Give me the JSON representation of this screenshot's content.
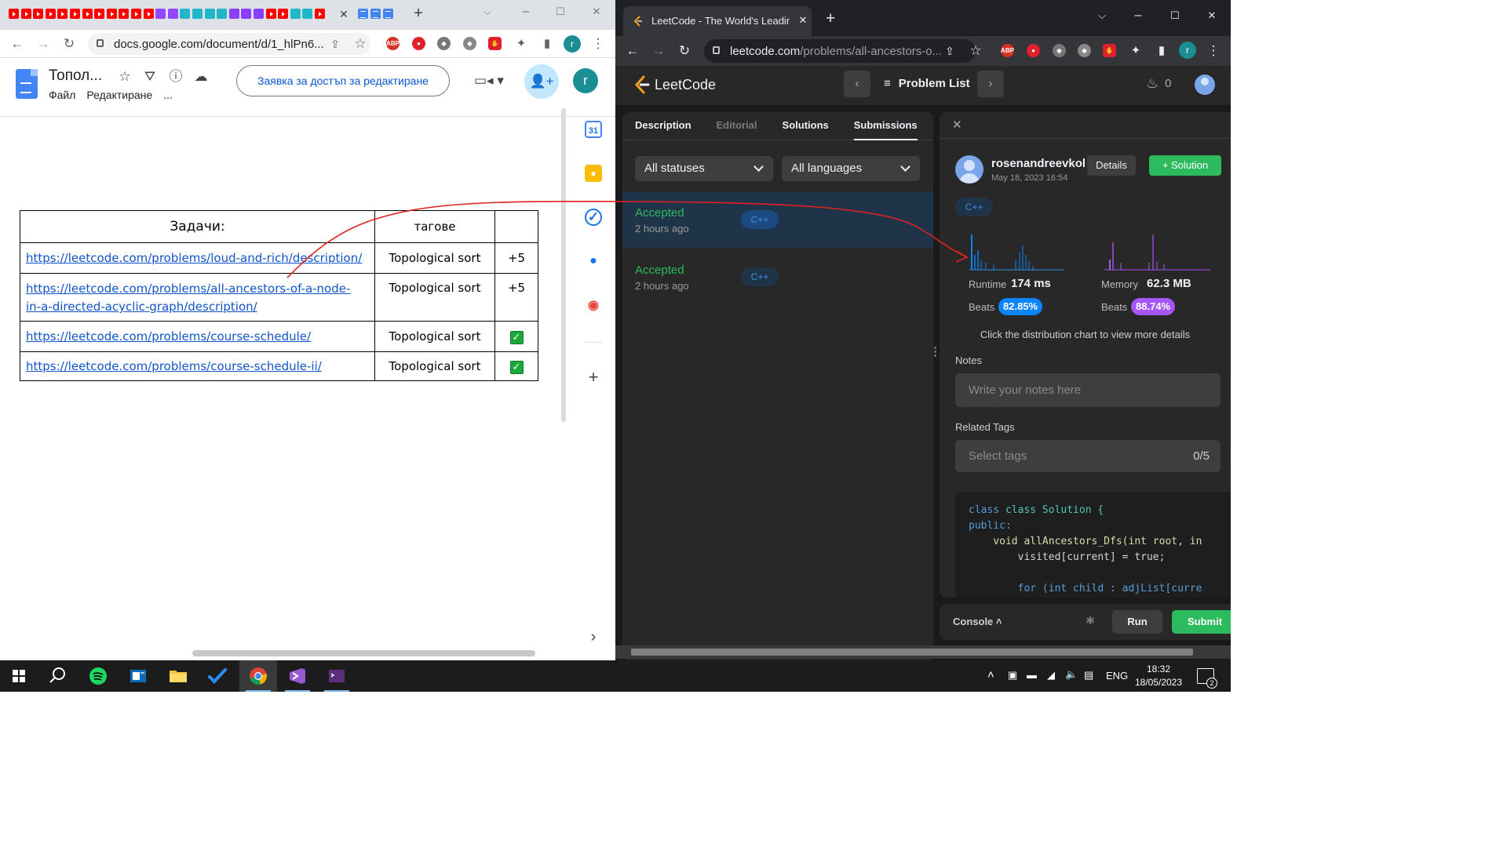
{
  "left_browser": {
    "tab_close": "✕",
    "new_tab": "+",
    "url": "docs.google.com/document/d/1_hlPn6...",
    "window_controls": {
      "minimize": "⌵",
      "maximize": "☐",
      "close": "✕"
    }
  },
  "docs": {
    "title": "Топол...",
    "menu": [
      "Файл",
      "Редактиране",
      "..."
    ],
    "request_edit_label": "Заявка за достъп за редактиране",
    "avatar_letter": "r",
    "table": {
      "header": {
        "tasks": "Задачи:",
        "tags": "тагове",
        "status": ""
      },
      "rows": [
        {
          "link": "https://leetcode.com/problems/loud-and-rich/description/",
          "tag": "Topological sort",
          "status": "+5",
          "done": false
        },
        {
          "link": "https://leetcode.com/problems/all-ancestors-of-a-node-in-a-directed-acyclic-graph/description/",
          "link_line1": "https://leetcode.com/problems/all-ancestors-of-a-node-",
          "link_line2": "in-a-directed-acyclic-graph/description/",
          "tag": "Topological sort",
          "status": "+5",
          "done": false
        },
        {
          "link": "https://leetcode.com/problems/course-schedule/",
          "tag": "Topological sort",
          "status": "✓",
          "done": true
        },
        {
          "link": "https://leetcode.com/problems/course-schedule-ii/",
          "tag": "Topological sort",
          "status": "✓",
          "done": true
        }
      ]
    },
    "side_panel": {
      "calendar_day": "31",
      "add": "+",
      "expand": "›"
    }
  },
  "right_browser": {
    "tab_title": "LeetCode - The World's Leading",
    "tab_close": "✕",
    "new_tab": "+",
    "url_host": "leetcode.com",
    "url_path": "/problems/all-ancestors-o...",
    "avatar_letter": "r",
    "window_controls": {
      "minimize": "⌵",
      "maximize": "☐",
      "close": "✕"
    }
  },
  "leetcode": {
    "logo_text": "LeetCode",
    "problem_list_label": "Problem List",
    "streak_count": "0",
    "tabs": [
      "Description",
      "Editorial",
      "Solutions",
      "Submissions"
    ],
    "filters": {
      "status": "All statuses",
      "language": "All languages"
    },
    "submissions": [
      {
        "status": "Accepted",
        "time": "2 hours ago",
        "lang": "C++"
      },
      {
        "status": "Accepted",
        "time": "2 hours ago",
        "lang": "C++"
      }
    ],
    "detail": {
      "close": "✕",
      "username": "rosenandreevkol...",
      "date": "May 18, 2023 16:54",
      "details_btn": "Details",
      "solution_btn": "Solution",
      "lang": "C++",
      "runtime_label": "Runtime",
      "runtime_value": "174 ms",
      "memory_label": "Memory",
      "memory_value": "62.3 MB",
      "beats_label": "Beats",
      "runtime_beats": "82.85%",
      "memory_beats": "88.74%",
      "hint": "Click the distribution chart to view more details",
      "notes_label": "Notes",
      "notes_placeholder": "Write your notes here",
      "tags_label": "Related Tags",
      "tags_placeholder": "Select tags",
      "tags_count": "0/5",
      "code_lines": [
        "class Solution {",
        "public:",
        "    void allAncestors_Dfs(int root, in",
        "        visited[current] = true;",
        "",
        "        for (int child : adjList[curre"
      ]
    },
    "console_label": "Console",
    "run_label": "Run",
    "submit_label": "Submit",
    "colors": {
      "accepted": "#2cbb5d",
      "runtime_pill": "#0a84ff",
      "memory_pill": "#a855f7"
    }
  },
  "taskbar": {
    "apps": [
      "start-icon",
      "search-icon",
      "spotify-icon",
      "outlook-icon",
      "file-explorer-icon",
      "todo-icon",
      "chrome-icon",
      "visual-studio-icon",
      "terminal-icon"
    ],
    "lang": "ENG",
    "time": "18:32",
    "date": "18/05/2023",
    "notifications": "2"
  }
}
